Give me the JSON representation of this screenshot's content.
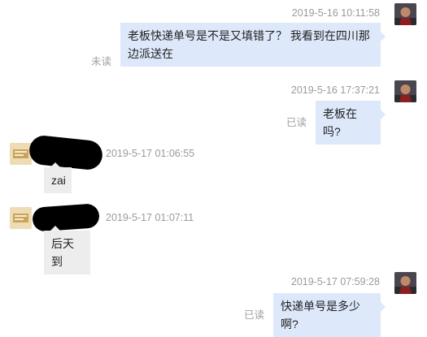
{
  "messages": [
    {
      "side": "me",
      "timestamp": "2019-5-16 10:11:58",
      "text": "老板快递单号是不是又填错了？ 我看到在四川那边派送在",
      "status": "未读"
    },
    {
      "side": "me",
      "timestamp": "2019-5-16 17:37:21",
      "text": "老板在吗?",
      "status": "已读"
    },
    {
      "side": "them",
      "timestamp": "2019-5-17 01:06:55",
      "text": "zai"
    },
    {
      "side": "them",
      "timestamp": "2019-5-17 01:07:11",
      "text": "后天到"
    },
    {
      "side": "me",
      "timestamp": "2019-5-17 07:59:28",
      "text": "快递单号是多少啊?",
      "status": "已读"
    }
  ],
  "colors": {
    "my_bubble": "#dde9fb",
    "their_bubble": "#ededed",
    "timestamp": "#9a9a9a",
    "status": "#a0a0a0"
  }
}
